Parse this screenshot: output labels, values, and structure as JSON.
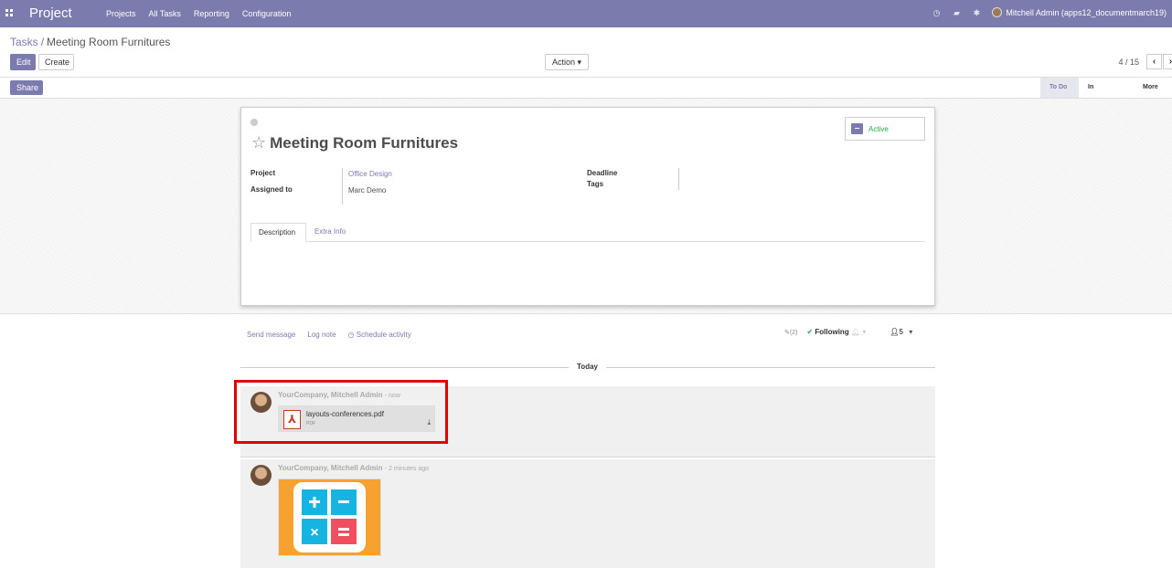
{
  "navbar": {
    "brand": "Project",
    "menu": [
      "Projects",
      "All Tasks",
      "Reporting",
      "Configuration"
    ],
    "user": "Mitchell Admin (apps12_documentmarch19)"
  },
  "breadcrumb": {
    "parent": "Tasks",
    "current": "Meeting Room Furnitures"
  },
  "toolbar": {
    "edit": "Edit",
    "create": "Create",
    "action": "Action",
    "pager": "4 / 15",
    "share": "Share"
  },
  "stages": {
    "todo": "To Do",
    "inprogress": "In Progress",
    "more": "More"
  },
  "task": {
    "title": "Meeting Room Furnitures",
    "active_label": "Active",
    "fields": {
      "project_label": "Project",
      "project_value": "Office Design",
      "assigned_label": "Assigned to",
      "assigned_value": "Marc Demo",
      "deadline_label": "Deadline",
      "tags_label": "Tags"
    },
    "tabs": [
      "Description",
      "Extra Info"
    ]
  },
  "chatter": {
    "send_message": "Send message",
    "log_note": "Log note",
    "schedule_activity": "Schedule activity",
    "attachments_count": "(2)",
    "following": "Following",
    "followers_count": "5",
    "today_label": "Today",
    "messages": [
      {
        "author": "YourCompany, Mitchell Admin",
        "date": "- now",
        "attachment_name": "layouts-conferences.pdf",
        "attachment_type": "PDF"
      },
      {
        "author": "YourCompany, Mitchell Admin",
        "date": "- 2 minutes ago"
      }
    ]
  },
  "colors": {
    "brand": "#7c7bad",
    "active": "#28a745",
    "highlight": "#e00000"
  }
}
